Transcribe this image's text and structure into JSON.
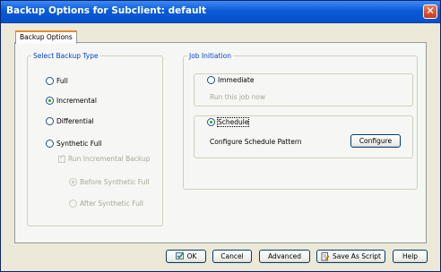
{
  "window": {
    "title": "Backup Options for Subclient: default"
  },
  "tabs": [
    {
      "label": "Backup Options"
    }
  ],
  "backup_type": {
    "legend": "Select Backup Type",
    "options": [
      {
        "label": "Full",
        "checked": false
      },
      {
        "label": "Incremental",
        "checked": true
      },
      {
        "label": "Differential",
        "checked": false
      },
      {
        "label": "Synthetic Full",
        "checked": false
      }
    ],
    "run_incremental": {
      "label": "Run Incremental Backup",
      "checked": true,
      "disabled": true
    },
    "sub_options": [
      {
        "label": "Before Synthetic Full",
        "checked": true,
        "disabled": true
      },
      {
        "label": "After Synthetic Full",
        "checked": false,
        "disabled": true
      }
    ]
  },
  "job_initiation": {
    "legend": "Job Initiation",
    "immediate": {
      "label": "Immediate",
      "checked": false,
      "note": "Run this job now"
    },
    "schedule": {
      "label": "Schedule",
      "checked": true,
      "pattern_label": "Configure Schedule Pattern",
      "configure_label": "Configure"
    }
  },
  "footer": {
    "ok": "OK",
    "cancel": "Cancel",
    "advanced": "Advanced",
    "save_as_script": "Save As Script",
    "help": "Help"
  },
  "colors": {
    "title_bar": "#0b5bd8",
    "legend_text": "#0046d5",
    "selected_radio": "#21a121",
    "tab_highlight": "#e68b2c"
  },
  "icons": {
    "close": "close-icon",
    "ok": "ok-check-icon",
    "save_script": "script-icon"
  }
}
